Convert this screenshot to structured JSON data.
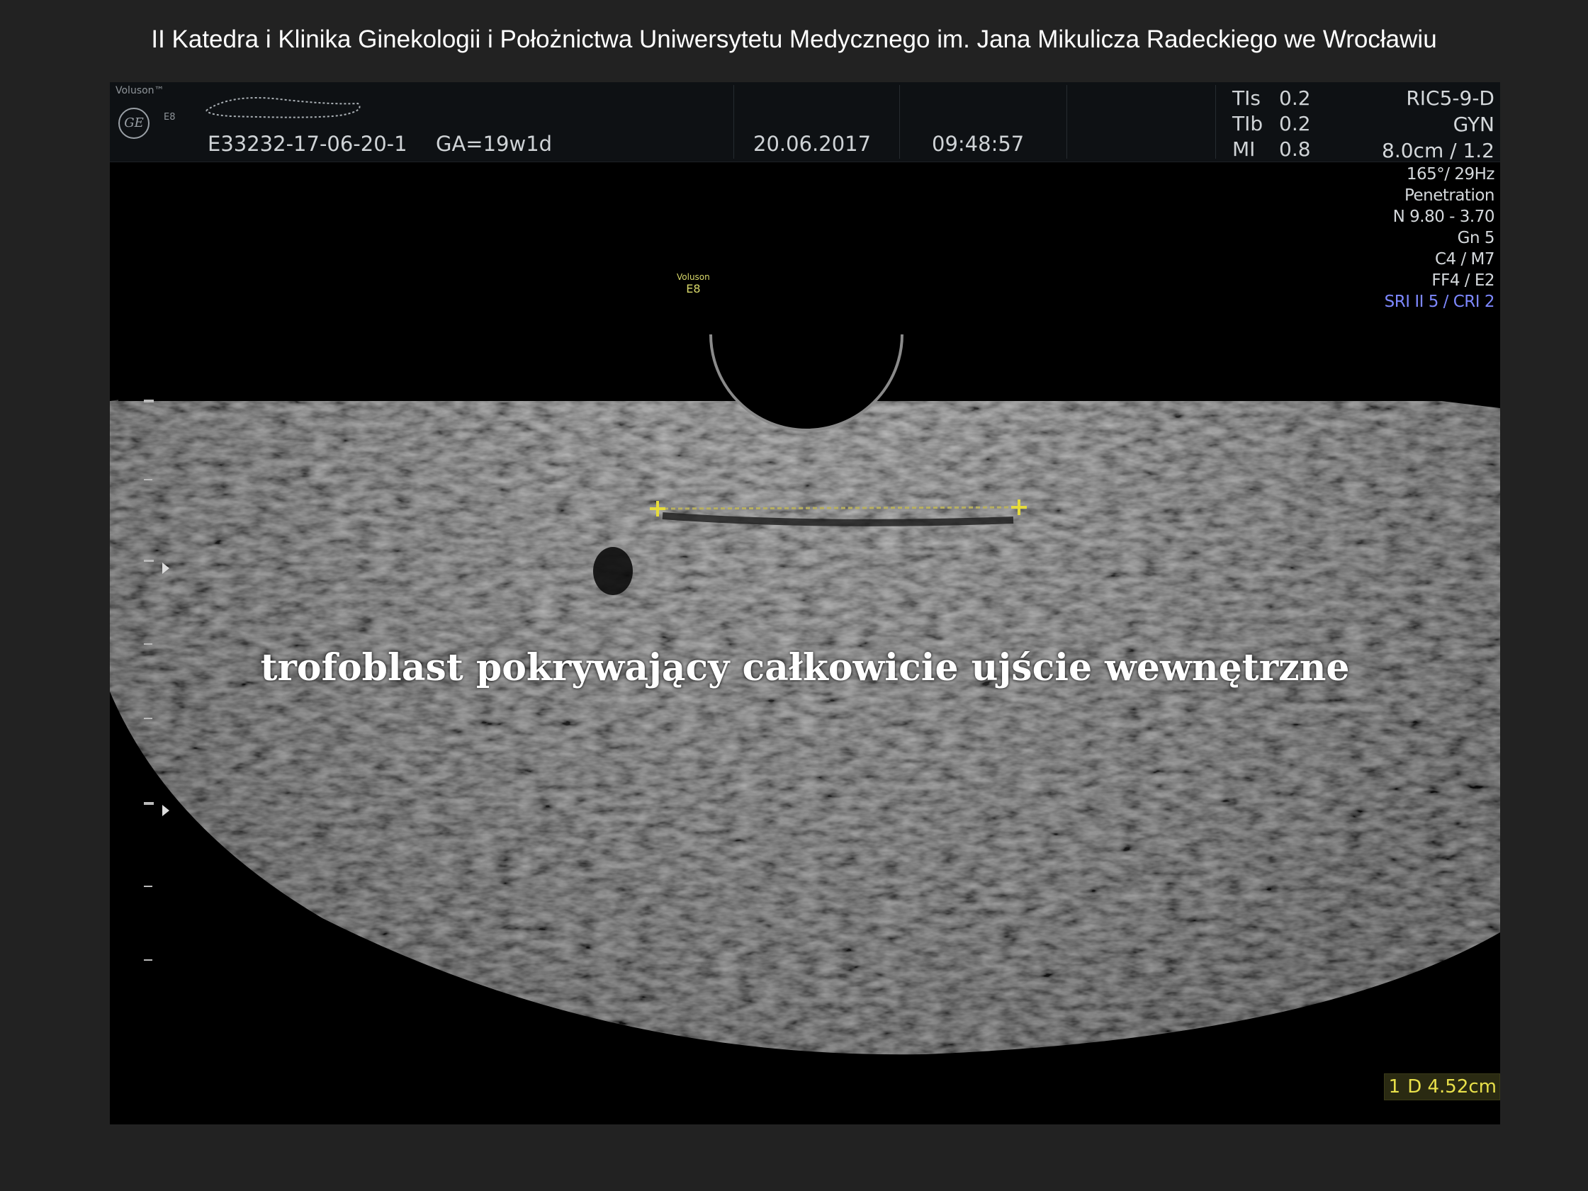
{
  "slide": {
    "title": "II Katedra i Klinika Ginekologii i Położnictwa Uniwersytetu Medycznego im. Jana Mikulicza Radeckiego we Wrocławiu"
  },
  "ultrasound": {
    "header": {
      "brand": "Voluson™",
      "logo": "GE",
      "logo_sub": "E8",
      "exam_id": "E33232-17-06-20-1",
      "ga": "GA=19w1d",
      "date": "20.06.2017",
      "time": "09:48:57",
      "indices": [
        {
          "name": "TIs",
          "value": "0.2"
        },
        {
          "name": "TIb",
          "value": "0.2"
        },
        {
          "name": "MI",
          "value": "0.8"
        }
      ]
    },
    "settings_main": [
      "RIC5-9-D",
      "GYN",
      "8.0cm / 1.2"
    ],
    "settings_small": [
      "165°/ 29Hz",
      "Penetration",
      "N 9.80 - 3.70",
      "Gn   5",
      "C4 / M7",
      "FF4 / E2"
    ],
    "settings_blue": "SRI II 5 / CRI 2",
    "probe_label": {
      "small": "Voluson",
      "big": "E8"
    },
    "overlay_text": "trofoblast pokrywający całkowicie ujście wewnętrzne",
    "measurement": {
      "index": "1",
      "text": "D 4.52cm"
    },
    "colors": {
      "caliper": "#e6dc3a",
      "blue_text": "#7d88ff",
      "frame": "#222222"
    }
  }
}
